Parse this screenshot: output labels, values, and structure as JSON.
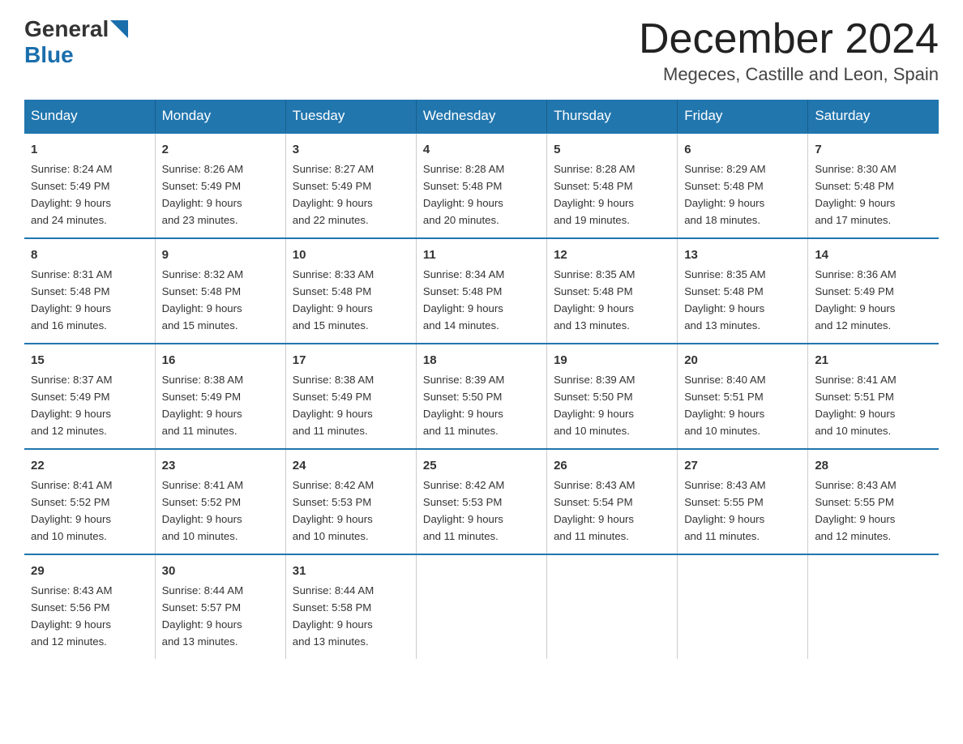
{
  "header": {
    "logo_general": "General",
    "logo_blue": "Blue",
    "month_title": "December 2024",
    "location": "Megeces, Castille and Leon, Spain"
  },
  "weekdays": [
    "Sunday",
    "Monday",
    "Tuesday",
    "Wednesday",
    "Thursday",
    "Friday",
    "Saturday"
  ],
  "weeks": [
    [
      {
        "day": "1",
        "sunrise": "8:24 AM",
        "sunset": "5:49 PM",
        "daylight": "9 hours and 24 minutes."
      },
      {
        "day": "2",
        "sunrise": "8:26 AM",
        "sunset": "5:49 PM",
        "daylight": "9 hours and 23 minutes."
      },
      {
        "day": "3",
        "sunrise": "8:27 AM",
        "sunset": "5:49 PM",
        "daylight": "9 hours and 22 minutes."
      },
      {
        "day": "4",
        "sunrise": "8:28 AM",
        "sunset": "5:48 PM",
        "daylight": "9 hours and 20 minutes."
      },
      {
        "day": "5",
        "sunrise": "8:28 AM",
        "sunset": "5:48 PM",
        "daylight": "9 hours and 19 minutes."
      },
      {
        "day": "6",
        "sunrise": "8:29 AM",
        "sunset": "5:48 PM",
        "daylight": "9 hours and 18 minutes."
      },
      {
        "day": "7",
        "sunrise": "8:30 AM",
        "sunset": "5:48 PM",
        "daylight": "9 hours and 17 minutes."
      }
    ],
    [
      {
        "day": "8",
        "sunrise": "8:31 AM",
        "sunset": "5:48 PM",
        "daylight": "9 hours and 16 minutes."
      },
      {
        "day": "9",
        "sunrise": "8:32 AM",
        "sunset": "5:48 PM",
        "daylight": "9 hours and 15 minutes."
      },
      {
        "day": "10",
        "sunrise": "8:33 AM",
        "sunset": "5:48 PM",
        "daylight": "9 hours and 15 minutes."
      },
      {
        "day": "11",
        "sunrise": "8:34 AM",
        "sunset": "5:48 PM",
        "daylight": "9 hours and 14 minutes."
      },
      {
        "day": "12",
        "sunrise": "8:35 AM",
        "sunset": "5:48 PM",
        "daylight": "9 hours and 13 minutes."
      },
      {
        "day": "13",
        "sunrise": "8:35 AM",
        "sunset": "5:48 PM",
        "daylight": "9 hours and 13 minutes."
      },
      {
        "day": "14",
        "sunrise": "8:36 AM",
        "sunset": "5:49 PM",
        "daylight": "9 hours and 12 minutes."
      }
    ],
    [
      {
        "day": "15",
        "sunrise": "8:37 AM",
        "sunset": "5:49 PM",
        "daylight": "9 hours and 12 minutes."
      },
      {
        "day": "16",
        "sunrise": "8:38 AM",
        "sunset": "5:49 PM",
        "daylight": "9 hours and 11 minutes."
      },
      {
        "day": "17",
        "sunrise": "8:38 AM",
        "sunset": "5:49 PM",
        "daylight": "9 hours and 11 minutes."
      },
      {
        "day": "18",
        "sunrise": "8:39 AM",
        "sunset": "5:50 PM",
        "daylight": "9 hours and 11 minutes."
      },
      {
        "day": "19",
        "sunrise": "8:39 AM",
        "sunset": "5:50 PM",
        "daylight": "9 hours and 10 minutes."
      },
      {
        "day": "20",
        "sunrise": "8:40 AM",
        "sunset": "5:51 PM",
        "daylight": "9 hours and 10 minutes."
      },
      {
        "day": "21",
        "sunrise": "8:41 AM",
        "sunset": "5:51 PM",
        "daylight": "9 hours and 10 minutes."
      }
    ],
    [
      {
        "day": "22",
        "sunrise": "8:41 AM",
        "sunset": "5:52 PM",
        "daylight": "9 hours and 10 minutes."
      },
      {
        "day": "23",
        "sunrise": "8:41 AM",
        "sunset": "5:52 PM",
        "daylight": "9 hours and 10 minutes."
      },
      {
        "day": "24",
        "sunrise": "8:42 AM",
        "sunset": "5:53 PM",
        "daylight": "9 hours and 10 minutes."
      },
      {
        "day": "25",
        "sunrise": "8:42 AM",
        "sunset": "5:53 PM",
        "daylight": "9 hours and 11 minutes."
      },
      {
        "day": "26",
        "sunrise": "8:43 AM",
        "sunset": "5:54 PM",
        "daylight": "9 hours and 11 minutes."
      },
      {
        "day": "27",
        "sunrise": "8:43 AM",
        "sunset": "5:55 PM",
        "daylight": "9 hours and 11 minutes."
      },
      {
        "day": "28",
        "sunrise": "8:43 AM",
        "sunset": "5:55 PM",
        "daylight": "9 hours and 12 minutes."
      }
    ],
    [
      {
        "day": "29",
        "sunrise": "8:43 AM",
        "sunset": "5:56 PM",
        "daylight": "9 hours and 12 minutes."
      },
      {
        "day": "30",
        "sunrise": "8:44 AM",
        "sunset": "5:57 PM",
        "daylight": "9 hours and 13 minutes."
      },
      {
        "day": "31",
        "sunrise": "8:44 AM",
        "sunset": "5:58 PM",
        "daylight": "9 hours and 13 minutes."
      },
      null,
      null,
      null,
      null
    ]
  ]
}
